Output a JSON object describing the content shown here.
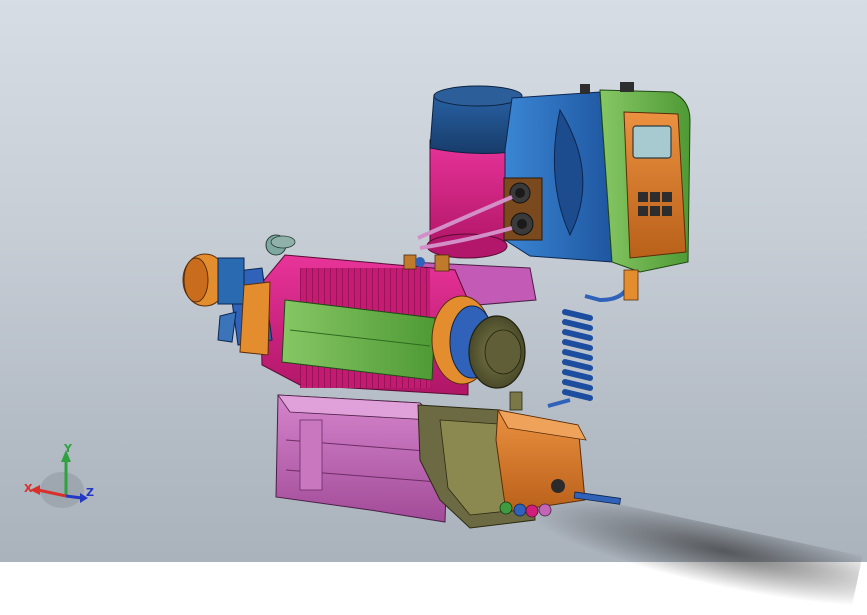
{
  "viewport": {
    "background_top": "#d7dde4",
    "background_bottom": "#aab2bc"
  },
  "model": {
    "name": "",
    "parts": [
      {
        "id": "motor-cap",
        "color": "#1f4f86"
      },
      {
        "id": "motor-body",
        "color": "#d21e7a"
      },
      {
        "id": "controller-housing",
        "color": "#2d6fc0"
      },
      {
        "id": "controller-cover",
        "color": "#73b24e"
      },
      {
        "id": "control-panel",
        "color": "#d97b23"
      },
      {
        "id": "display",
        "color": "#a3c7c9"
      },
      {
        "id": "gear-housing",
        "color": "#d21e7a"
      },
      {
        "id": "green-plate",
        "color": "#6fbf4a"
      },
      {
        "id": "base",
        "color": "#c066b5"
      },
      {
        "id": "end-cap",
        "color": "#6b6a3d"
      },
      {
        "id": "pump-head",
        "color": "#d97b23"
      },
      {
        "id": "suction-nozzle",
        "color": "#d97b23"
      },
      {
        "id": "cable",
        "color": "#2f62b8"
      }
    ]
  },
  "triad": {
    "x_label": "X",
    "y_label": "Y",
    "z_label": "Z",
    "x_color": "#d9302b",
    "y_color": "#2fa140",
    "z_color": "#2438c4"
  }
}
